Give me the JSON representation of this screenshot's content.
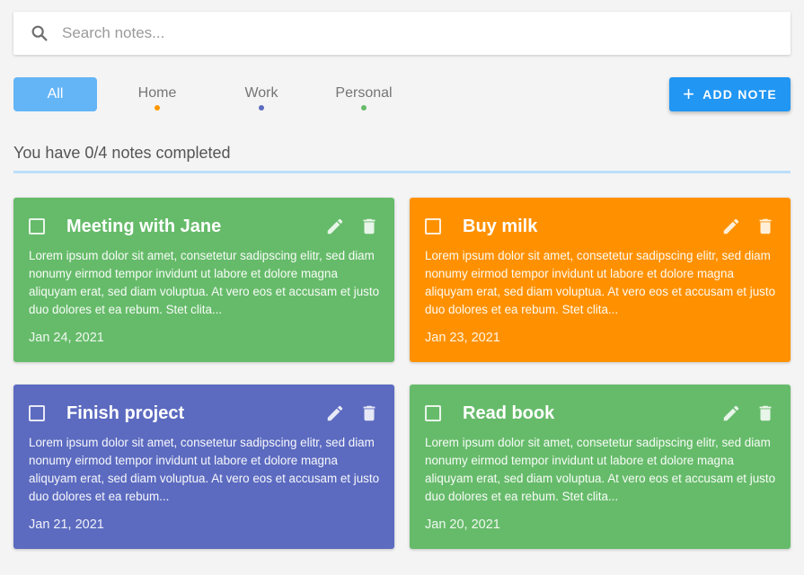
{
  "search": {
    "placeholder": "Search notes..."
  },
  "tabs": [
    {
      "label": "All",
      "dot_color": ""
    },
    {
      "label": "Home",
      "dot_color": "#ff9800"
    },
    {
      "label": "Work",
      "dot_color": "#5c6bc0"
    },
    {
      "label": "Personal",
      "dot_color": "#66bb6a"
    }
  ],
  "add_button": {
    "label": "ADD NOTE"
  },
  "status": {
    "text": "You have 0/4 notes completed"
  },
  "colors": {
    "accent": "#2196f3",
    "home": "#ff9800",
    "work": "#5c6bc0",
    "personal": "#66bb6a"
  },
  "notes": [
    {
      "title": "Meeting with Jane",
      "body": "Lorem ipsum dolor sit amet, consetetur sadipscing elitr, sed diam nonumy eirmod tempor invidunt ut labore et dolore magna aliquyam erat, sed diam voluptua. At vero eos et accusam et justo duo dolores et ea rebum. Stet clita...",
      "date": "Jan 24, 2021",
      "color": "#66bb6a",
      "completed": false
    },
    {
      "title": "Buy milk",
      "body": "Lorem ipsum dolor sit amet, consetetur sadipscing elitr, sed diam nonumy eirmod tempor invidunt ut labore et dolore magna aliquyam erat, sed diam voluptua. At vero eos et accusam et justo duo dolores et ea rebum. Stet clita...",
      "date": "Jan 23, 2021",
      "color": "#ff9100",
      "completed": false
    },
    {
      "title": "Finish project",
      "body": "Lorem ipsum dolor sit amet, consetetur sadipscing elitr, sed diam nonumy eirmod tempor invidunt ut labore et dolore magna aliquyam erat, sed diam voluptua. At vero eos et accusam et justo duo dolores et ea rebum...",
      "date": "Jan 21, 2021",
      "color": "#5c6bc0",
      "completed": false
    },
    {
      "title": "Read book",
      "body": "Lorem ipsum dolor sit amet, consetetur sadipscing elitr, sed diam nonumy eirmod tempor invidunt ut labore et dolore magna aliquyam erat, sed diam voluptua. At vero eos et accusam et justo duo dolores et ea rebum. Stet clita...",
      "date": "Jan 20, 2021",
      "color": "#66bb6a",
      "completed": false
    }
  ],
  "icons": {
    "search": "search-icon",
    "add": "plus-icon",
    "edit": "pencil-icon",
    "delete": "trash-icon"
  }
}
